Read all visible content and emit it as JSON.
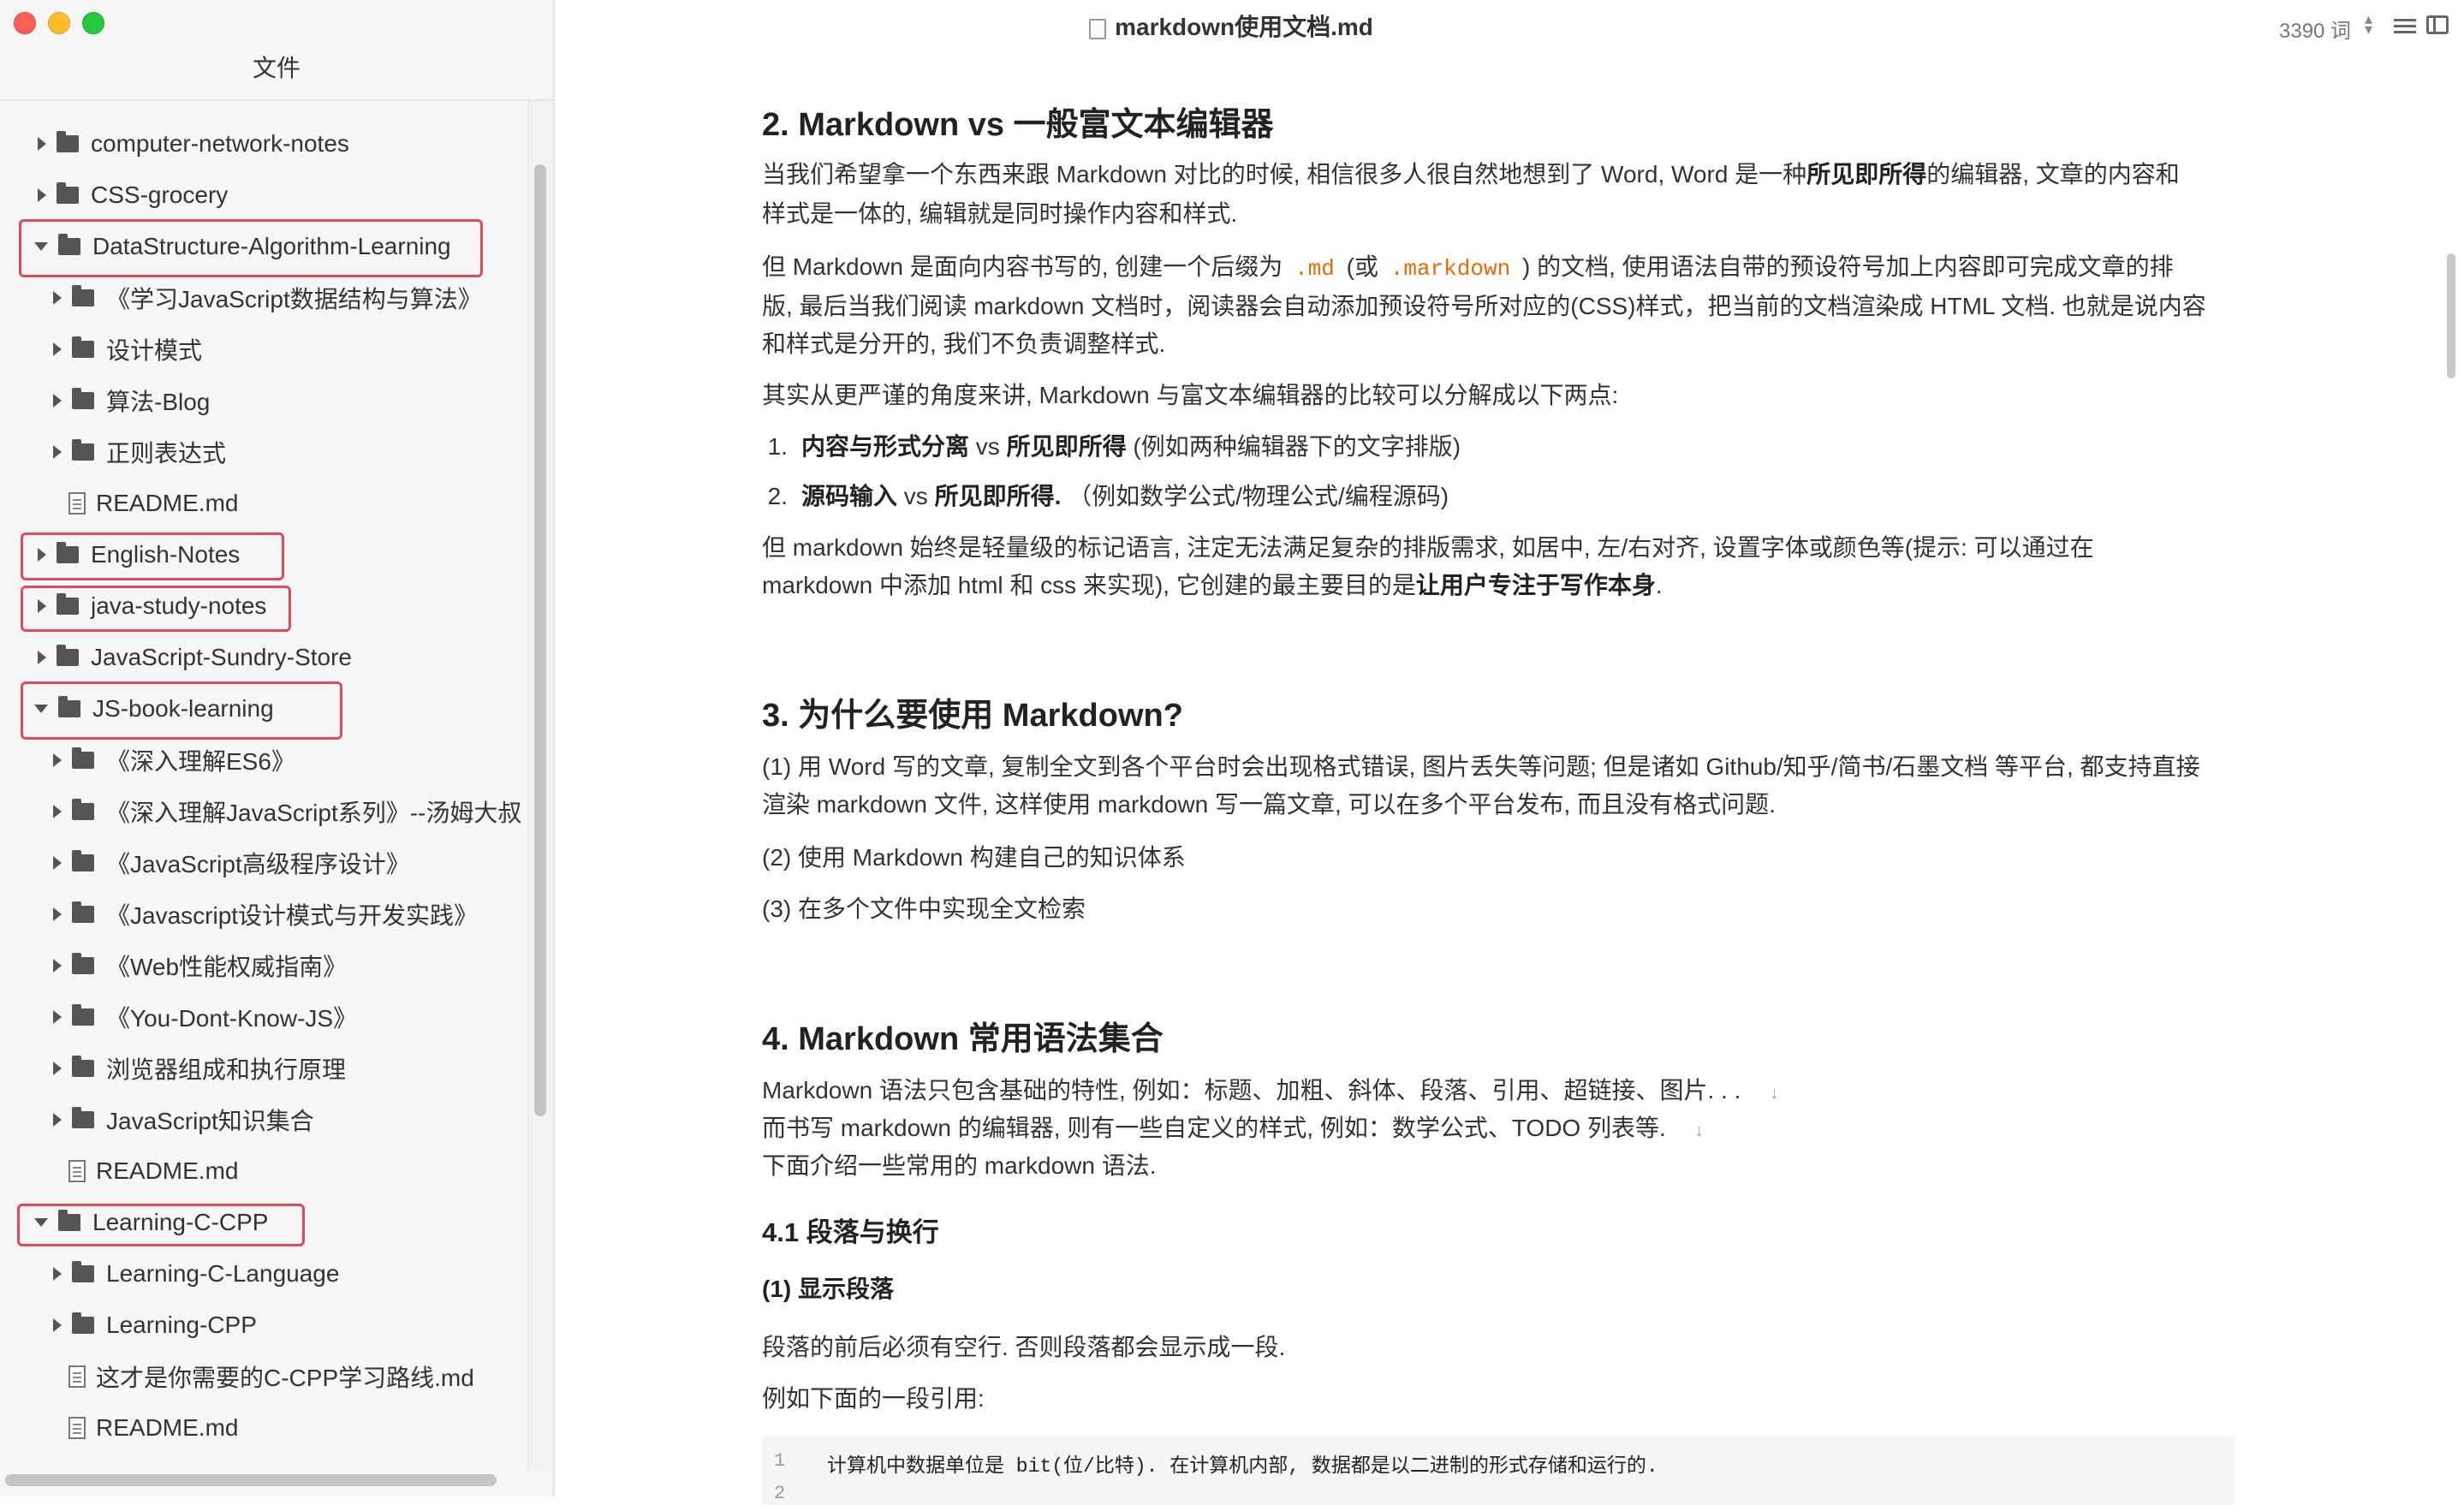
{
  "window": {
    "doc_title": "markdown使用文档.md",
    "word_count": "3390 词",
    "icons": [
      "close-icon",
      "minimize-icon",
      "zoom-icon",
      "document-icon",
      "stepper-icon",
      "outline-icon",
      "sidebar-toggle-icon"
    ]
  },
  "sidebar": {
    "title": "文件",
    "items": [
      {
        "label": "computer-network-notes",
        "type": "folder",
        "expanded": false
      },
      {
        "label": "CSS-grocery",
        "type": "folder",
        "expanded": false
      },
      {
        "label": "DataStructure-Algorithm-Learning",
        "type": "folder",
        "expanded": true,
        "highlighted": true
      },
      {
        "label": "《学习JavaScript数据结构与算法》",
        "type": "folder",
        "expanded": false
      },
      {
        "label": "设计模式",
        "type": "folder",
        "expanded": false
      },
      {
        "label": "算法-Blog",
        "type": "folder",
        "expanded": false
      },
      {
        "label": "正则表达式",
        "type": "folder",
        "expanded": false
      },
      {
        "label": "README.md",
        "type": "file"
      },
      {
        "label": "English-Notes",
        "type": "folder",
        "expanded": false,
        "highlighted": true
      },
      {
        "label": "java-study-notes",
        "type": "folder",
        "expanded": false,
        "highlighted": true
      },
      {
        "label": "JavaScript-Sundry-Store",
        "type": "folder",
        "expanded": false
      },
      {
        "label": "JS-book-learning",
        "type": "folder",
        "expanded": true,
        "highlighted": true
      },
      {
        "label": "《深入理解ES6》",
        "type": "folder",
        "expanded": false
      },
      {
        "label": "《深入理解JavaScript系列》--汤姆大叔",
        "type": "folder",
        "expanded": false
      },
      {
        "label": "《JavaScript高级程序设计》",
        "type": "folder",
        "expanded": false
      },
      {
        "label": "《Javascript设计模式与开发实践》",
        "type": "folder",
        "expanded": false
      },
      {
        "label": "《Web性能权威指南》",
        "type": "folder",
        "expanded": false
      },
      {
        "label": "《You-Dont-Know-JS》",
        "type": "folder",
        "expanded": false
      },
      {
        "label": "浏览器组成和执行原理",
        "type": "folder",
        "expanded": false
      },
      {
        "label": "JavaScript知识集合",
        "type": "folder",
        "expanded": false
      },
      {
        "label": "README.md",
        "type": "file"
      },
      {
        "label": "Learning-C-CPP",
        "type": "folder",
        "expanded": true,
        "highlighted": true
      },
      {
        "label": "Learning-C-Language",
        "type": "folder",
        "expanded": false
      },
      {
        "label": "Learning-CPP",
        "type": "folder",
        "expanded": false
      },
      {
        "label": "这才是你需要的C-CPP学习路线.md",
        "type": "file"
      },
      {
        "label": "README.md",
        "type": "file"
      }
    ],
    "highlight_color": "#e24a5a"
  },
  "content": {
    "s2": {
      "heading": "2. Markdown vs 一般富文本编辑器",
      "p1a": "当我们希望拿一个东西来跟 Markdown 对比的时候, 相信很多人很自然地想到了 Word, Word 是一种",
      "p1b": "所见即所得",
      "p1c": "的编辑器, 文章的内容和",
      "p1d": "样式是一体的, 编辑就是同时操作内容和样式.",
      "p2a": "但 Markdown 是面向内容书写的, 创建一个后缀为",
      "code1": ".md",
      "p2b": "(或",
      "code2": ".markdown",
      "p2c": ") 的文档, 使用语法自带的预设符号加上内容即可完成文章的排",
      "p2d": "版, 最后当我们阅读 markdown 文档时，阅读器会自动添加预设符号所对应的(CSS)样式，把当前的文档渲染成 HTML 文档. 也就是说内容",
      "p2e": "和样式是分开的, 我们不负责调整样式.",
      "p3": "其实从更严谨的角度来讲, Markdown 与富文本编辑器的比较可以分解成以下两点:",
      "li1_no": "1.",
      "li1_bold": "内容与形式分离",
      "li1_vs": " vs ",
      "li1_bold2": "所见即所得",
      "li1_rest": " (例如两种编辑器下的文字排版)",
      "li2_no": "2.",
      "li2_bold": "源码输入",
      "li2_vs": " vs ",
      "li2_bold2": "所见即所得.",
      "li2_rest": " （例如数学公式/物理公式/编程源码)",
      "p4a": "但 markdown 始终是轻量级的标记语言, 注定无法满足复杂的排版需求, 如居中, 左/右对齐, 设置字体或颜色等(提示: 可以通过在",
      "p4b": "markdown 中添加 html 和 css 来实现), 它创建的最主要目的是",
      "p4c": "让用户专注于写作本身",
      "p4d": "."
    },
    "s3": {
      "heading": "3. 为什么要使用 Markdown?",
      "p1a": "(1) 用 Word 写的文章, 复制全文到各个平台时会出现格式错误, 图片丢失等问题; 但是诸如 Github/知乎/简书/石墨文档 等平台, 都支持直接",
      "p1b": "渲染 markdown 文件, 这样使用 markdown 写一篇文章, 可以在多个平台发布, 而且没有格式问题.",
      "p2": "(2) 使用 Markdown 构建自己的知识体系",
      "p3": "(3) 在多个文件中实现全文检索"
    },
    "s4": {
      "heading": "4. Markdown 常用语法集合",
      "l1": "Markdown 语法只包含基础的特性, 例如：标题、加粗、斜体、段落、引用、超链接、图片. . .",
      "l2": "而书写 markdown 的编辑器, 则有一些自定义的样式, 例如：数学公式、TODO 列表等.",
      "l3": "下面介绍一些常用的 markdown 语法.",
      "linebreak": "↓",
      "h41": "4.1 段落与换行",
      "h41a": "(1) 显示段落",
      "p5": "段落的前后必须有空行. 否则段落都会显示成一段.",
      "p6": "例如下面的一段引用:",
      "code_line_no": "1",
      "code_line_no2": "2",
      "code_line": "计算机中数据单位是 bit(位/比特). 在计算机内部, 数据都是以二进制的形式存储和运行的."
    }
  }
}
